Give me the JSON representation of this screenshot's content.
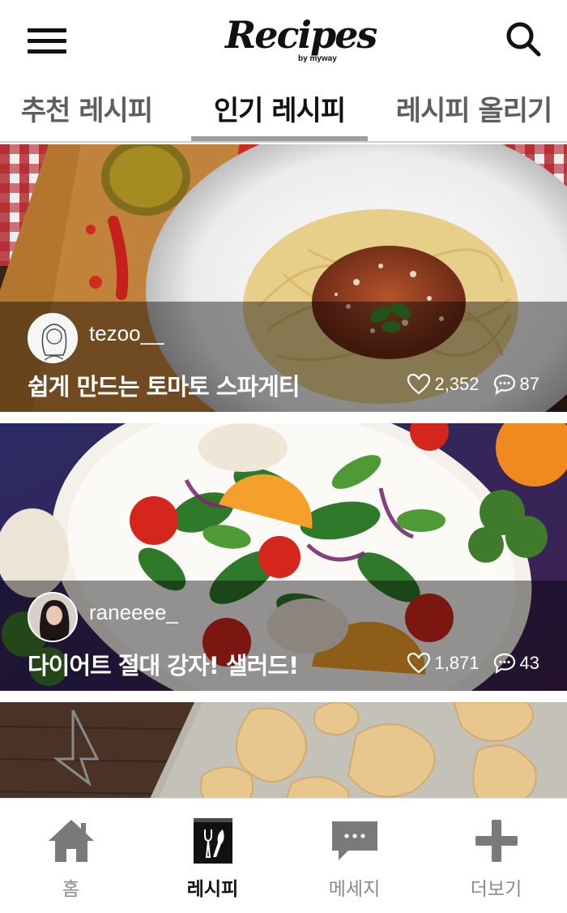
{
  "header": {
    "logo_main": "Recipes",
    "logo_sub": "by myway",
    "menu_icon": "hamburger-menu-icon",
    "search_icon": "search-icon"
  },
  "tabs": [
    {
      "label": "추천 레시피",
      "active": false
    },
    {
      "label": "인기 레시피",
      "active": true
    },
    {
      "label": "레시피 올리기",
      "active": false
    }
  ],
  "feed": {
    "cards": [
      {
        "username": "tezoo__",
        "title": "쉽게 만드는 토마토 스파게티",
        "likes": "2,352",
        "comments": "87",
        "image": "spaghetti-bolognese-photo"
      },
      {
        "username": "raneeee_",
        "title": "다이어트 절대 강자! 샐러드!",
        "likes": "1,871",
        "comments": "43",
        "image": "salad-photo"
      },
      {
        "image": "cookies-photo"
      }
    ]
  },
  "bottom_nav": {
    "items": [
      {
        "label": "홈",
        "icon": "home-icon",
        "active": false
      },
      {
        "label": "레시피",
        "icon": "recipe-icon",
        "active": true
      },
      {
        "label": "메세지",
        "icon": "message-icon",
        "active": false
      },
      {
        "label": "더보기",
        "icon": "plus-icon",
        "active": false
      }
    ]
  },
  "colors": {
    "active_text": "#111111",
    "inactive_text": "#5e5e5e",
    "nav_inactive": "#8a8a8a",
    "tab_indicator": "#9e9e9e"
  }
}
